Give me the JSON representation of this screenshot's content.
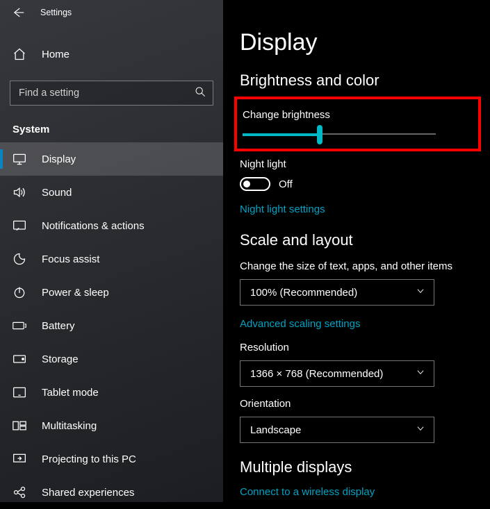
{
  "titlebar": {
    "title": "Settings"
  },
  "home": {
    "label": "Home"
  },
  "search": {
    "placeholder": "Find a setting"
  },
  "section": {
    "header": "System"
  },
  "nav": [
    {
      "key": "display",
      "label": "Display"
    },
    {
      "key": "sound",
      "label": "Sound"
    },
    {
      "key": "notifications",
      "label": "Notifications & actions"
    },
    {
      "key": "focus",
      "label": "Focus assist"
    },
    {
      "key": "power",
      "label": "Power & sleep"
    },
    {
      "key": "battery",
      "label": "Battery"
    },
    {
      "key": "storage",
      "label": "Storage"
    },
    {
      "key": "tablet",
      "label": "Tablet mode"
    },
    {
      "key": "multitask",
      "label": "Multitasking"
    },
    {
      "key": "projecting",
      "label": "Projecting to this PC"
    },
    {
      "key": "shared",
      "label": "Shared experiences"
    }
  ],
  "main": {
    "page_title": "Display",
    "section_brightness": "Brightness and color",
    "brightness_label": "Change brightness",
    "brightness_value_pct": 40,
    "night_light_label": "Night light",
    "night_light_state": "Off",
    "night_light_link": "Night light settings",
    "section_scale": "Scale and layout",
    "scale_label": "Change the size of text, apps, and other items",
    "scale_value": "100% (Recommended)",
    "adv_scaling_link": "Advanced scaling settings",
    "resolution_label": "Resolution",
    "resolution_value": "1366 × 768 (Recommended)",
    "orientation_label": "Orientation",
    "orientation_value": "Landscape",
    "section_multi": "Multiple displays",
    "wireless_link": "Connect to a wireless display"
  }
}
